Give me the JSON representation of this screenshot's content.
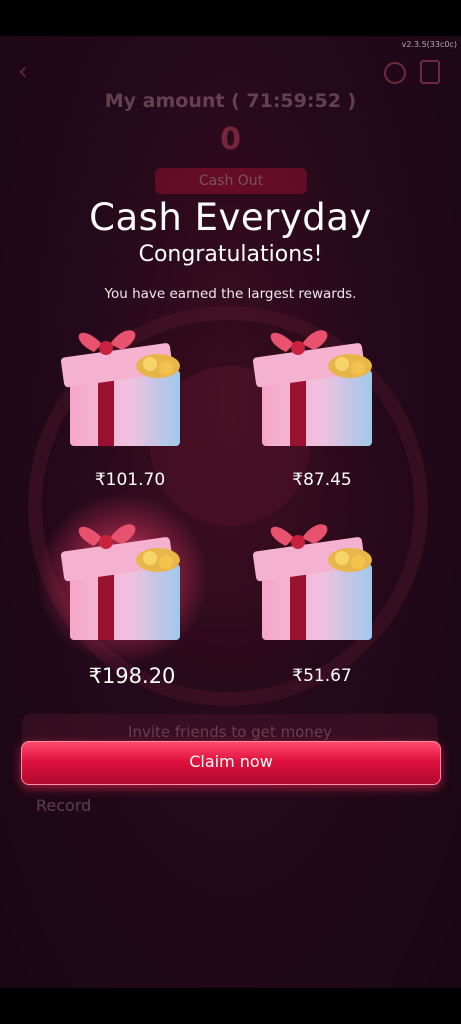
{
  "version": "v2.3.5(33c0c)",
  "background": {
    "amount_title": "My amount ( 71:59:52 )",
    "amount_value": "0",
    "cash_out_label": "Cash Out",
    "invite_label": "Invite friends to get money",
    "record_label": "Record"
  },
  "modal": {
    "title": "Cash Everyday",
    "subtitle": "Congratulations!",
    "description": "You have earned the largest rewards.",
    "rewards": [
      {
        "amount": "₹101.70"
      },
      {
        "amount": "₹87.45"
      },
      {
        "amount": "₹198.20"
      },
      {
        "amount": "₹51.67"
      }
    ],
    "claim_label": "Claim now"
  },
  "colors": {
    "accent": "#e0123e",
    "background": "#24091a"
  }
}
